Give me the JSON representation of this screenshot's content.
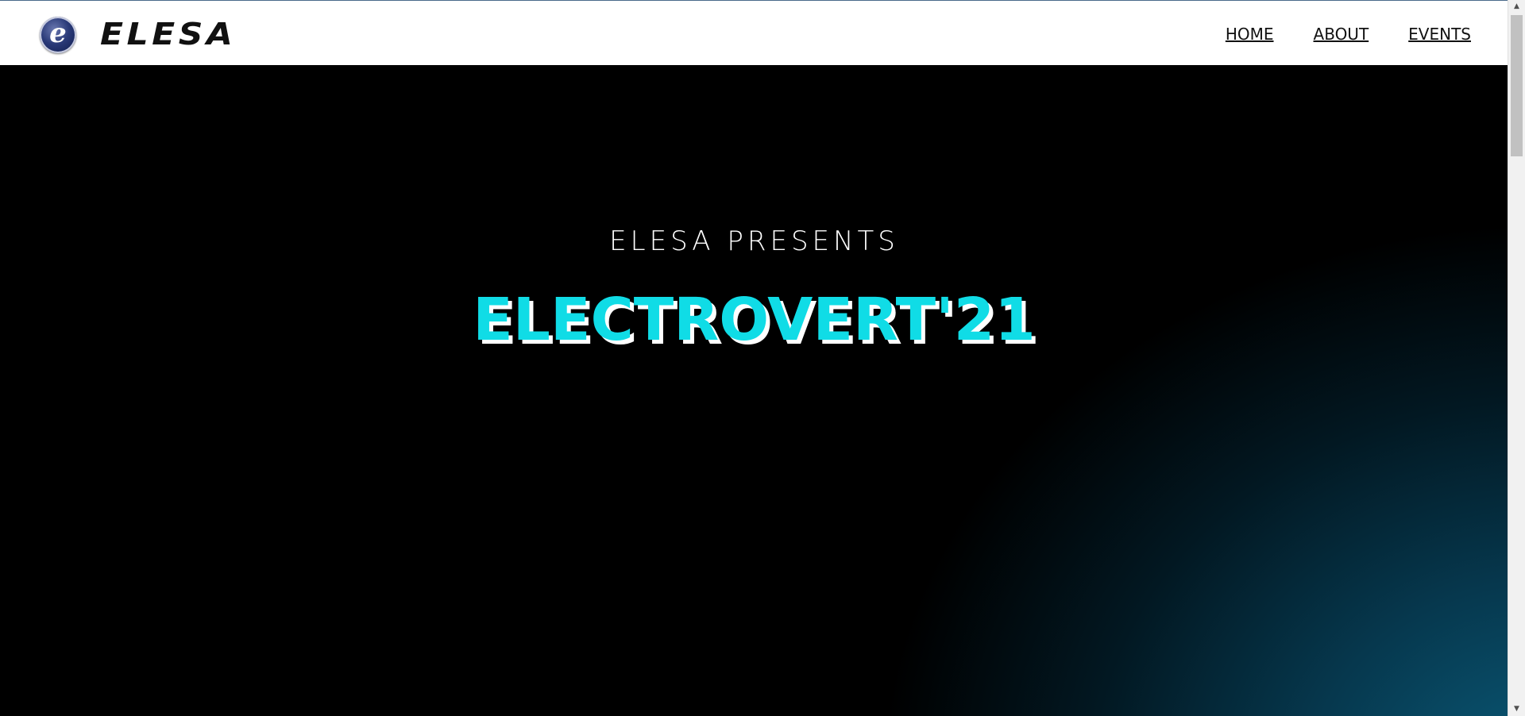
{
  "header": {
    "logo_letter": "e",
    "brand": "ELESA",
    "nav": [
      {
        "label": "HOME"
      },
      {
        "label": "ABOUT"
      },
      {
        "label": "EVENTS"
      }
    ]
  },
  "hero": {
    "presents": "ELESA PRESENTS",
    "title": "ELECTROVERT'21"
  },
  "colors": {
    "title": "#10dce6",
    "background": "#000000",
    "glow": "#0a5a78"
  },
  "scrollbar": {
    "up_icon": "▲",
    "down_icon": "▼"
  }
}
